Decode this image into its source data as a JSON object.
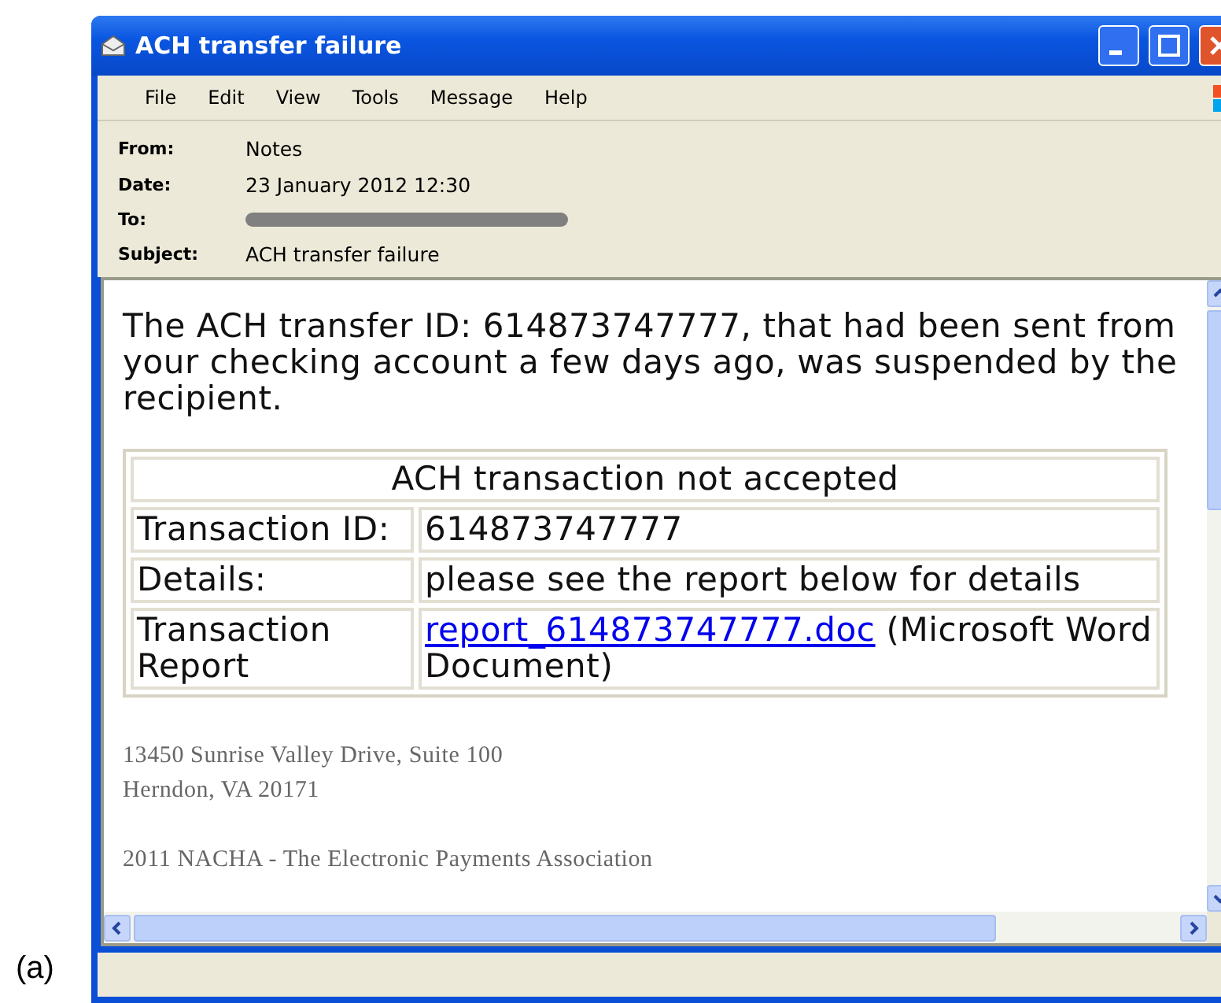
{
  "figure_label": "(a)",
  "window": {
    "title": "ACH transfer failure"
  },
  "menu": [
    "File",
    "Edit",
    "View",
    "Tools",
    "Message",
    "Help"
  ],
  "headers": [
    {
      "label": "From:",
      "value": "Notes",
      "redacted": false
    },
    {
      "label": "Date:",
      "value": "23 January 2012 12:30",
      "redacted": false
    },
    {
      "label": "To:",
      "redacted": true
    },
    {
      "label": "Subject:",
      "value": "ACH transfer failure",
      "redacted": false
    }
  ],
  "body": {
    "intro": "The ACH transfer ID: 614873747777, that had been sent from your checking account a few days ago, was suspended by the recipient.",
    "table": {
      "title": "ACH transaction not accepted",
      "rows": [
        {
          "label": "Transaction ID:",
          "value": "614873747777"
        },
        {
          "label": "Details:",
          "value": "please see the report below for details"
        },
        {
          "label": "Transaction Report",
          "link": "report_614873747777.doc",
          "value": "(Microsoft Word Document)"
        }
      ]
    },
    "address": [
      "13450 Sunrise Valley Drive, Suite 100",
      "Herndon, VA 20171"
    ],
    "footer": "2011 NACHA - The Electronic Payments Association"
  }
}
